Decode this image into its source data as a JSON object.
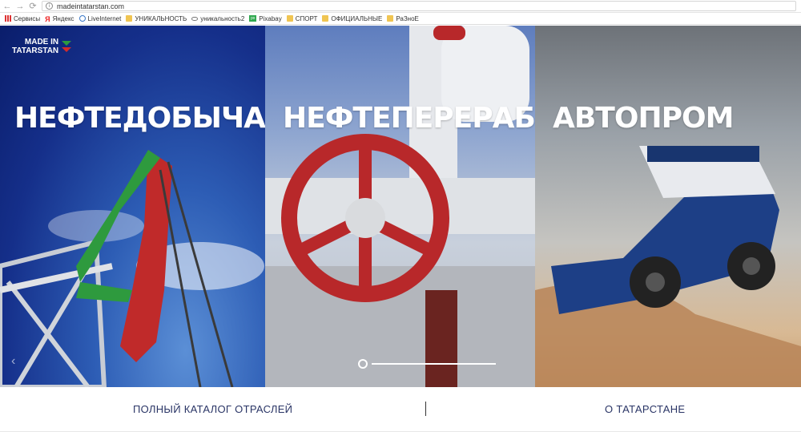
{
  "browser": {
    "url": "madeintatarstan.com",
    "bookmarks": [
      {
        "label": "Сервисы",
        "icon": "apps-icon"
      },
      {
        "label": "Яндекс",
        "icon": "yandex-icon"
      },
      {
        "label": "LiveInternet",
        "icon": "globe-icon"
      },
      {
        "label": "УНИКАЛЬНОСТЬ",
        "icon": "folder-icon"
      },
      {
        "label": "уникальность2",
        "icon": "eye-icon"
      },
      {
        "label": "Pixabay",
        "icon": "pixabay-icon"
      },
      {
        "label": "СПОРТ",
        "icon": "folder-icon"
      },
      {
        "label": "ОФИЦИАЛЬНЫЕ",
        "icon": "folder-icon"
      },
      {
        "label": "РаЗноЕ",
        "icon": "folder-icon"
      }
    ]
  },
  "site": {
    "logo_line1": "MADE IN",
    "logo_line2": "TATARSTAN",
    "flag_colors": [
      "#2e9a3e",
      "#ffffff",
      "#d42b2b"
    ]
  },
  "panels": [
    {
      "title": "НЕФТЕДОБЫЧА"
    },
    {
      "title": "НЕФТЕПЕРЕРАБОТКА"
    },
    {
      "title": "АВТОПРОМ"
    }
  ],
  "slider": {
    "prev_arrow": "‹"
  },
  "footer": {
    "left_link": "ПОЛНЫЙ КАТАЛОГ ОТРАСЛЕЙ",
    "right_link": "О ТАТАРСТАНЕ"
  }
}
